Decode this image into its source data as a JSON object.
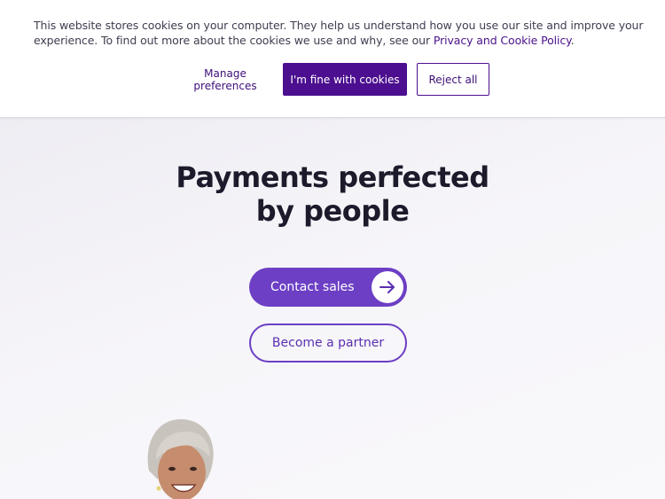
{
  "cookie_banner": {
    "text_before_link": "This website stores cookies on your computer. They help us understand how you use our site and improve your experience. To find out more about the cookies we use and why, see our ",
    "link_label": "Privacy and Cookie Policy",
    "text_after_link": ".",
    "manage_label": "Manage preferences",
    "accept_label": "I'm fine with cookies",
    "reject_label": "Reject all"
  },
  "hero": {
    "title_line1": "Payments perfected",
    "title_line2": "by people",
    "contact_label": "Contact sales",
    "contact_icon": "arrow-right-icon",
    "partner_label": "Become a partner"
  },
  "colors": {
    "brand_purple": "#4c0f8f",
    "accent_purple": "#6c3fc4"
  }
}
